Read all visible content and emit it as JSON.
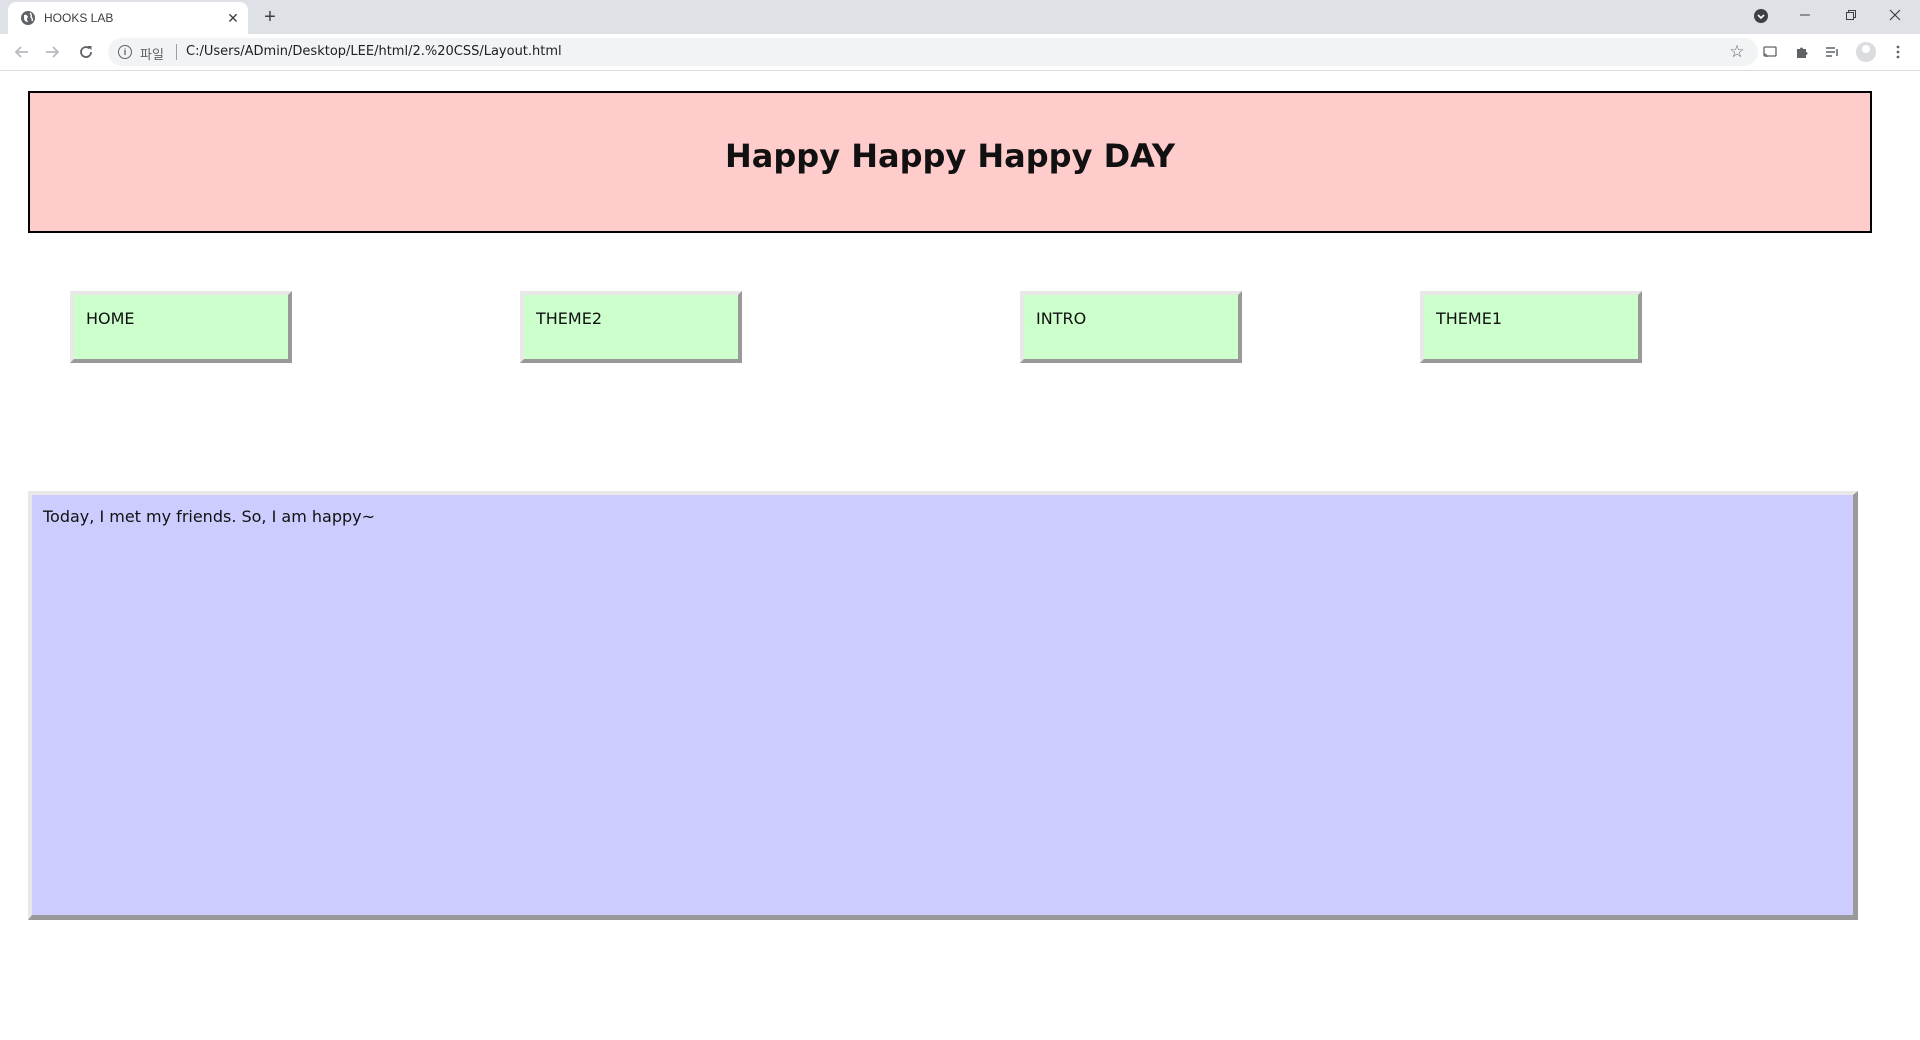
{
  "browser": {
    "tab_title": "HOOKS LAB",
    "tab_close": "✕",
    "new_tab": "+",
    "scheme_label": "파일",
    "url": "C:/Users/ADmin/Desktop/LEE/html/2.%20CSS/Layout.html"
  },
  "page": {
    "header_title": "Happy Happy Happy DAY",
    "menu": [
      {
        "label": "HOME"
      },
      {
        "label": "THEME2"
      },
      {
        "label": "INTRO"
      },
      {
        "label": "THEME1"
      }
    ],
    "content_text": "Today, I met my friends. So, I am happy~"
  },
  "colors": {
    "header_bg": "#ffcccc",
    "menu_bg": "#ccffcc",
    "content_bg": "#ccccff"
  }
}
